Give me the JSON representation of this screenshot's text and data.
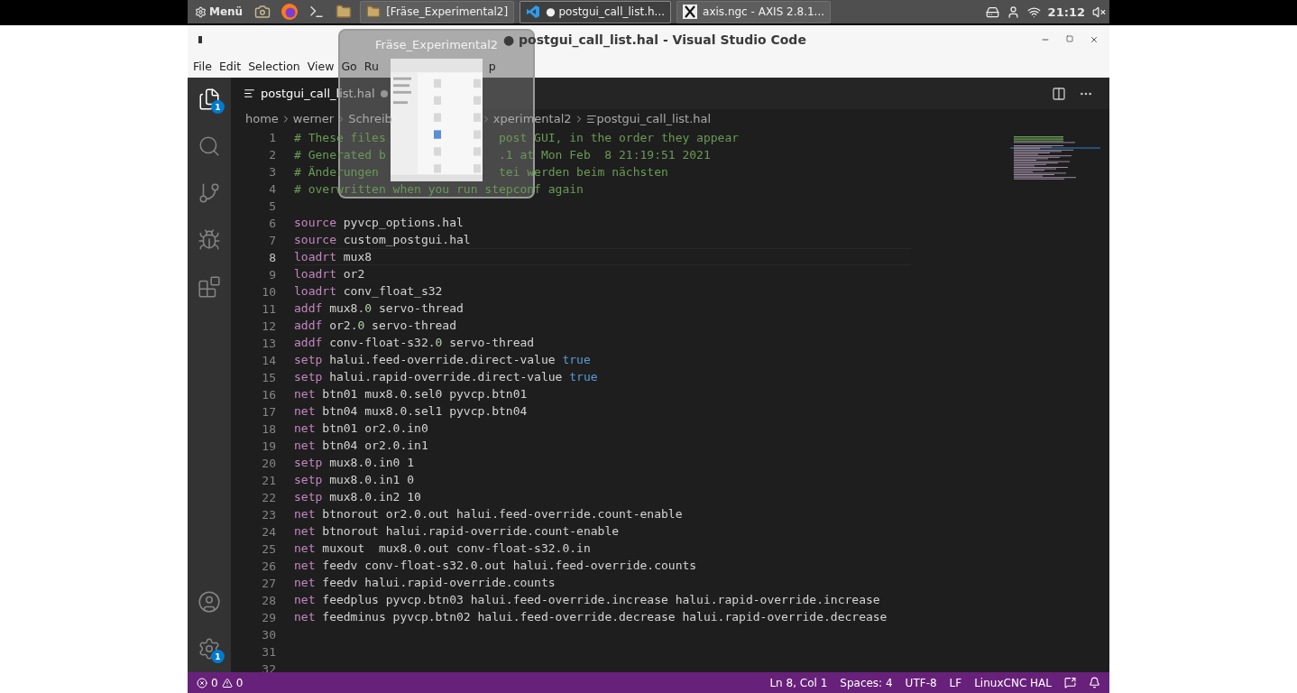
{
  "taskbar": {
    "menu_label": "Menü",
    "tasks": [
      {
        "label": "[Fräse_Experimental2]",
        "kind": "folder",
        "selected": false
      },
      {
        "label": "● postgui_call_list.h...",
        "kind": "vscode",
        "selected": true
      },
      {
        "label": "axis.ngc - AXIS 2.8.1...",
        "kind": "axis",
        "selected": false
      }
    ],
    "clock": "21:12"
  },
  "window": {
    "title": "● postgui_call_list.hal - Visual Studio Code"
  },
  "preview": {
    "title": "Fräse_Experimental2"
  },
  "menu": [
    "File",
    "Edit",
    "Selection",
    "View",
    "Go",
    "Ru",
    "p"
  ],
  "activity_bar": {
    "items": [
      {
        "kind": "explorer",
        "badge": "1"
      },
      {
        "kind": "search"
      },
      {
        "kind": "source-control"
      },
      {
        "kind": "run"
      },
      {
        "kind": "extensions"
      }
    ],
    "bottom": [
      {
        "kind": "account"
      },
      {
        "kind": "settings",
        "badge": "1"
      }
    ]
  },
  "editor_tab": {
    "label": "postgui_call_list.hal",
    "selected": true,
    "dirty": true
  },
  "breadcrumbs": [
    "home",
    "werner",
    "Schreib",
    "xperimental2",
    "postgui_call_list.hal"
  ],
  "lines": [
    {
      "number": "1",
      "current": false,
      "segments": [
        [
          {
            "kind": "comment",
            "text": "# These files"
          }
        ],
        [
          {
            "kind": "comment",
            "text": "post GUI, in the order they appear"
          }
        ]
      ]
    },
    {
      "number": "2",
      "current": false,
      "segments": [
        [
          {
            "kind": "comment",
            "text": "# Generated b"
          }
        ],
        [
          {
            "kind": "comment",
            "text": ".1 at Mon Feb  8 21:19:51 2021"
          }
        ]
      ]
    },
    {
      "number": "3",
      "current": false,
      "segments": [
        [
          {
            "kind": "comment",
            "text": "# Änderungen"
          }
        ],
        [
          {
            "kind": "comment",
            "text": "tei werden beim nächsten"
          }
        ]
      ]
    },
    {
      "number": "4",
      "current": false,
      "segments": [
        [
          {
            "kind": "comment",
            "text": "# overwritten when you run stepconf again"
          }
        ]
      ]
    },
    {
      "number": "5",
      "current": false
    },
    {
      "number": "6",
      "current": false,
      "segments": [
        [
          {
            "kind": "keyword",
            "text": "source"
          },
          {
            "kind": "plain",
            "text": " pyvcp_options.hal"
          }
        ]
      ]
    },
    {
      "number": "7",
      "current": false,
      "segments": [
        [
          {
            "kind": "keyword",
            "text": "source"
          },
          {
            "kind": "plain",
            "text": " custom_postgui.hal"
          }
        ]
      ]
    },
    {
      "number": "8",
      "current": true,
      "segments": [
        [
          {
            "kind": "keyword",
            "text": "loadrt"
          },
          {
            "kind": "plain",
            "text": " mux8"
          }
        ]
      ]
    },
    {
      "number": "9",
      "current": false,
      "segments": [
        [
          {
            "kind": "keyword",
            "text": "loadrt"
          },
          {
            "kind": "plain",
            "text": " or2"
          }
        ]
      ]
    },
    {
      "number": "10",
      "current": false,
      "segments": [
        [
          {
            "kind": "keyword",
            "text": "loadrt"
          },
          {
            "kind": "plain",
            "text": " conv_float_s32"
          }
        ]
      ]
    },
    {
      "number": "11",
      "current": false,
      "segments": [
        [
          {
            "kind": "keyword",
            "text": "addf"
          },
          {
            "kind": "plain",
            "text": " mux8"
          },
          {
            "kind": "number",
            "text": ".0"
          },
          {
            "kind": "plain",
            "text": " servo-thread"
          }
        ]
      ]
    },
    {
      "number": "12",
      "current": false,
      "segments": [
        [
          {
            "kind": "keyword",
            "text": "addf"
          },
          {
            "kind": "plain",
            "text": " or2"
          },
          {
            "kind": "number",
            "text": ".0"
          },
          {
            "kind": "plain",
            "text": " servo-thread"
          }
        ]
      ]
    },
    {
      "number": "13",
      "current": false,
      "segments": [
        [
          {
            "kind": "keyword",
            "text": "addf"
          },
          {
            "kind": "plain",
            "text": " conv-float-s32"
          },
          {
            "kind": "number",
            "text": ".0"
          },
          {
            "kind": "plain",
            "text": " servo-thread"
          }
        ]
      ]
    },
    {
      "number": "14",
      "current": false,
      "segments": [
        [
          {
            "kind": "keyword",
            "text": "setp"
          },
          {
            "kind": "plain",
            "text": " halui.feed-override.direct-value "
          },
          {
            "kind": "literal",
            "text": "true"
          }
        ]
      ]
    },
    {
      "number": "15",
      "current": false,
      "segments": [
        [
          {
            "kind": "keyword",
            "text": "setp"
          },
          {
            "kind": "plain",
            "text": " halui.rapid-override.direct-value "
          },
          {
            "kind": "literal",
            "text": "true"
          }
        ]
      ]
    },
    {
      "number": "16",
      "current": false,
      "segments": [
        [
          {
            "kind": "keyword",
            "text": "net"
          },
          {
            "kind": "plain",
            "text": " btn01 mux8.0.sel0 pyvcp.btn01"
          }
        ]
      ]
    },
    {
      "number": "17",
      "current": false,
      "segments": [
        [
          {
            "kind": "keyword",
            "text": "net"
          },
          {
            "kind": "plain",
            "text": " btn04 mux8.0.sel1 pyvcp.btn04"
          }
        ]
      ]
    },
    {
      "number": "18",
      "current": false,
      "segments": [
        [
          {
            "kind": "keyword",
            "text": "net"
          },
          {
            "kind": "plain",
            "text": " btn01 or2.0.in0"
          }
        ]
      ]
    },
    {
      "number": "19",
      "current": false,
      "segments": [
        [
          {
            "kind": "keyword",
            "text": "net"
          },
          {
            "kind": "plain",
            "text": " btn04 or2.0.in1"
          }
        ]
      ]
    },
    {
      "number": "20",
      "current": false,
      "segments": [
        [
          {
            "kind": "keyword",
            "text": "setp"
          },
          {
            "kind": "plain",
            "text": " mux8.0.in0 1"
          }
        ]
      ]
    },
    {
      "number": "21",
      "current": false,
      "segments": [
        [
          {
            "kind": "keyword",
            "text": "setp"
          },
          {
            "kind": "plain",
            "text": " mux8.0.in1 0"
          }
        ]
      ]
    },
    {
      "number": "22",
      "current": false,
      "segments": [
        [
          {
            "kind": "keyword",
            "text": "setp"
          },
          {
            "kind": "plain",
            "text": " mux8.0.in2 10"
          }
        ]
      ]
    },
    {
      "number": "23",
      "current": false,
      "segments": [
        [
          {
            "kind": "keyword",
            "text": "net"
          },
          {
            "kind": "plain",
            "text": " btnorout or2.0.out halui.feed-override.count-enable"
          }
        ]
      ]
    },
    {
      "number": "24",
      "current": false,
      "segments": [
        [
          {
            "kind": "keyword",
            "text": "net"
          },
          {
            "kind": "plain",
            "text": " btnorout halui.rapid-override.count-enable"
          }
        ]
      ]
    },
    {
      "number": "25",
      "current": false,
      "segments": [
        [
          {
            "kind": "keyword",
            "text": "net"
          },
          {
            "kind": "plain",
            "text": " muxout  mux8.0.out conv-float-s32.0.in"
          }
        ]
      ]
    },
    {
      "number": "26",
      "current": false,
      "segments": [
        [
          {
            "kind": "keyword",
            "text": "net"
          },
          {
            "kind": "plain",
            "text": " feedv conv-float-s32.0.out halui.feed-override.counts"
          }
        ]
      ]
    },
    {
      "number": "27",
      "current": false,
      "segments": [
        [
          {
            "kind": "keyword",
            "text": "net"
          },
          {
            "kind": "plain",
            "text": " feedv halui.rapid-override.counts"
          }
        ]
      ]
    },
    {
      "number": "28",
      "current": false,
      "segments": [
        [
          {
            "kind": "keyword",
            "text": "net"
          },
          {
            "kind": "plain",
            "text": " feedplus pyvcp.btn03 halui.feed-override.increase halui.rapid-override.increase"
          }
        ]
      ]
    },
    {
      "number": "29",
      "current": false,
      "segments": [
        [
          {
            "kind": "keyword",
            "text": "net"
          },
          {
            "kind": "plain",
            "text": " feedminus pyvcp.btn02 halui.feed-override.decrease halui.rapid-override.decrease"
          }
        ]
      ]
    },
    {
      "number": "30",
      "current": false
    },
    {
      "number": "31",
      "current": false
    },
    {
      "number": "32",
      "current": false
    }
  ],
  "status_bar": {
    "errors": "0",
    "warnings": "0",
    "items": [
      "Ln 8, Col 1",
      "Spaces: 4",
      "UTF-8",
      "LF",
      "LinuxCNC HAL"
    ]
  }
}
